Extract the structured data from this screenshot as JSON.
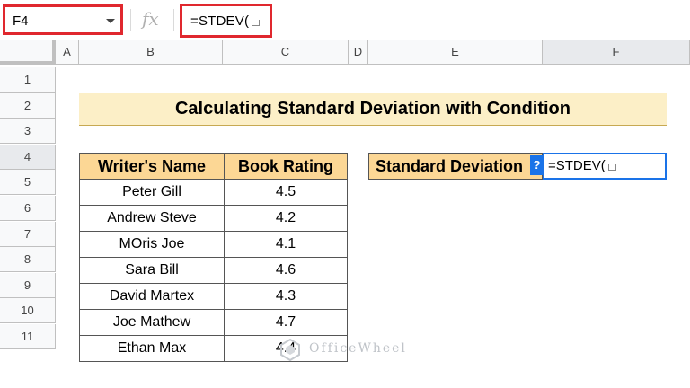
{
  "formula_bar": {
    "name_box": "F4",
    "fx_label": "fx",
    "formula": "=STDEV("
  },
  "columns": [
    "A",
    "B",
    "C",
    "D",
    "E",
    "F"
  ],
  "rows": [
    "1",
    "2",
    "3",
    "4",
    "5",
    "6",
    "7",
    "8",
    "9",
    "10",
    "11"
  ],
  "sheet": {
    "title": "Calculating Standard Deviation with Condition",
    "table_headers": [
      "Writer's Name",
      "Book Rating"
    ],
    "table_rows": [
      {
        "name": "Peter Gill",
        "rating": "4.5"
      },
      {
        "name": "Andrew Steve",
        "rating": "4.2"
      },
      {
        "name": "MOris Joe",
        "rating": "4.1"
      },
      {
        "name": "Sara Bill",
        "rating": "4.6"
      },
      {
        "name": "David Martex",
        "rating": "4.3"
      },
      {
        "name": "Joe Mathew",
        "rating": "4.7"
      },
      {
        "name": "Ethan Max",
        "rating": "4.4"
      }
    ],
    "sd_label": "Standard Deviation",
    "active_cell_value": "=STDEV(",
    "help_label": "?"
  },
  "watermark": "OfficeWheel",
  "colors": {
    "highlight_red": "#e0282e",
    "header_fill": "#fcd795",
    "title_fill": "#fcefc7",
    "selection_blue": "#1a73e8"
  }
}
